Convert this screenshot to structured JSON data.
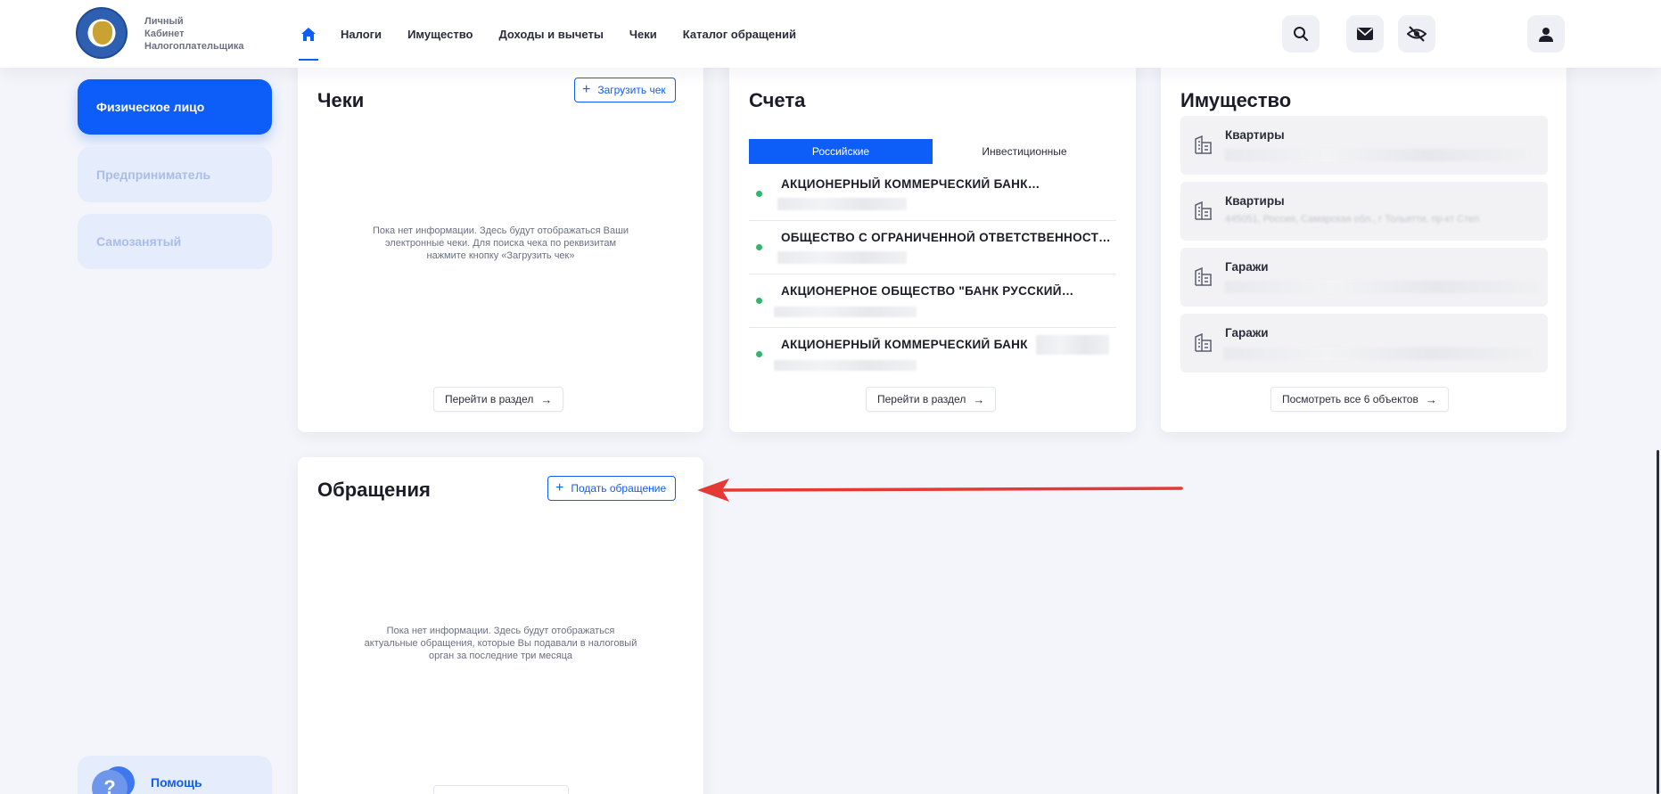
{
  "header": {
    "logo_lines": [
      "Личный",
      "Кабинет",
      "Налогоплательщика"
    ],
    "nav": [
      "Налоги",
      "Имущество",
      "Доходы и вычеты",
      "Чеки",
      "Каталог обращений"
    ]
  },
  "sidebar": {
    "items": [
      {
        "label": "Физическое лицо",
        "active": true
      },
      {
        "label": "Предприниматель",
        "active": false
      },
      {
        "label": "Самозанятый",
        "active": false
      }
    ],
    "help": "Помощь",
    "help_glyph": "?"
  },
  "receipts": {
    "title": "Чеки",
    "upload_label": "Загрузить чек",
    "empty_lines": [
      "Пока нет информации. Здесь будут отображаться Ваши",
      "электронные чеки. Для поиска чека по реквизитам",
      "нажмите кнопку «Загрузить чек»"
    ],
    "goto_label": "Перейти в раздел"
  },
  "accounts": {
    "title": "Счета",
    "tabs": [
      "Российские",
      "Инвестиционные"
    ],
    "rows": [
      "АКЦИОНЕРНЫЙ КОММЕРЧЕСКИЙ БАНК…",
      "ОБЩЕСТВО С ОГРАНИЧЕННОЙ ОТВЕТСТВЕННОСТЬ…",
      "АКЦИОНЕРНОЕ ОБЩЕСТВО \"БАНК РУССКИЙ…",
      "АКЦИОНЕРНЫЙ КОММЕРЧЕСКИЙ БАНК"
    ],
    "goto_label": "Перейти в раздел"
  },
  "property": {
    "title": "Имущество",
    "items": [
      {
        "title": "Квартиры",
        "addr": ""
      },
      {
        "title": "Квартиры",
        "addr": "445051, Россия, Самарская обл., г Тольятти, пр-кт Степ"
      },
      {
        "title": "Гаражи",
        "addr": ""
      },
      {
        "title": "Гаражи",
        "addr": ""
      }
    ],
    "view_all_label": "Посмотреть все 6 объектов"
  },
  "appeals": {
    "title": "Обращения",
    "submit_label": "Подать обращение",
    "empty_lines": [
      "Пока нет информации. Здесь будут отображаться",
      "актуальные обращения, которые Вы подавали в налоговый",
      "орган за последние три месяца"
    ]
  },
  "colors": {
    "accent": "#0d5df9",
    "annotation": "#e53935",
    "status_ok": "#31b46b"
  }
}
